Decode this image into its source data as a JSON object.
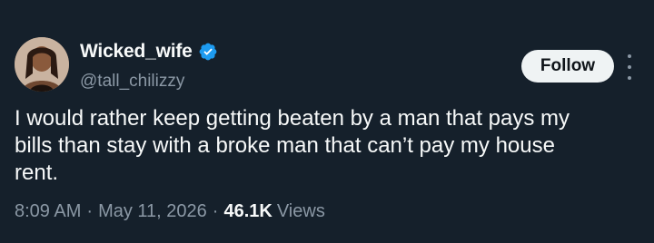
{
  "author": {
    "display_name": "Wicked_wife",
    "handle": "@tall_chilizzy",
    "verified": true,
    "verified_color": "#1d9bf0"
  },
  "actions": {
    "follow_label": "Follow"
  },
  "tweet": {
    "text": "I would rather keep getting beaten by a man that pays my\nbills than stay with a broke man that can’t pay my house\nrent.",
    "time": "8:09 AM",
    "separator": "·",
    "date": "May 11, 2026",
    "views_count": "46.1K",
    "views_label": "Views"
  },
  "icons": {
    "verified": "verified-badge-icon",
    "more": "more-horizontal-icon"
  },
  "colors": {
    "background": "#15202b",
    "text_primary": "#f7f9f9",
    "text_secondary": "#8b98a5",
    "button_bg": "#eff3f4"
  }
}
